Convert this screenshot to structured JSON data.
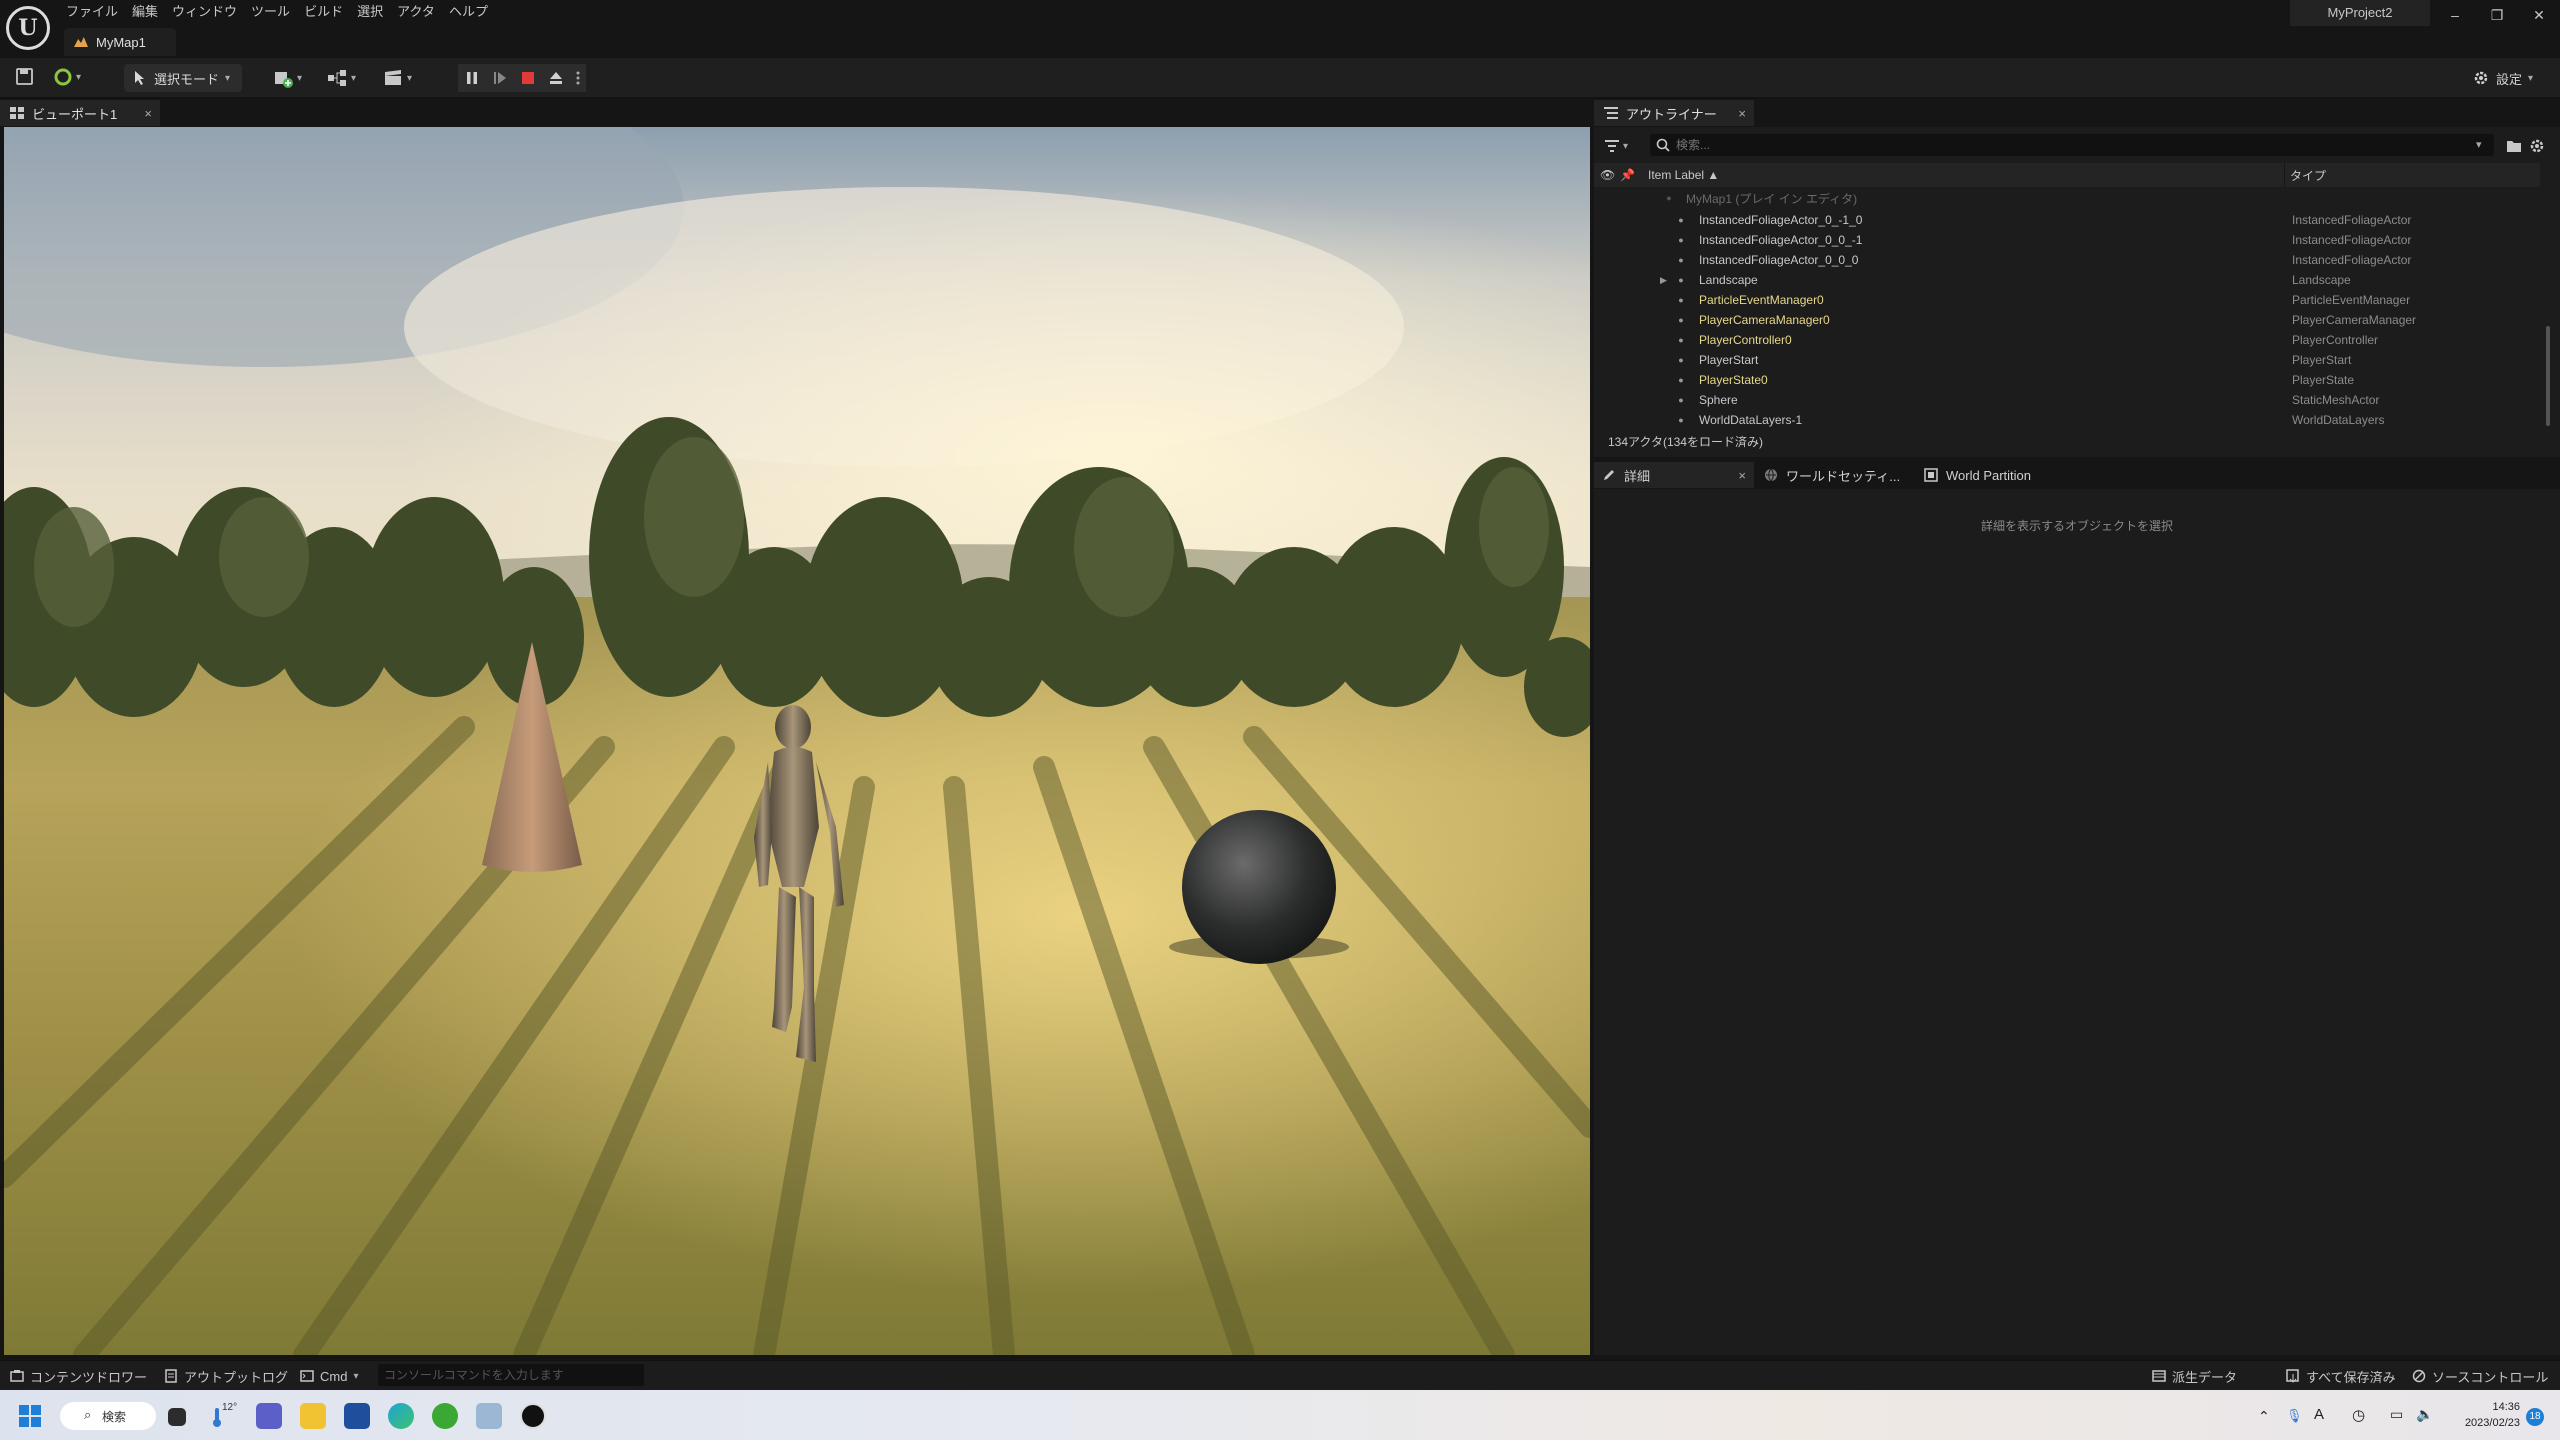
{
  "titlebar": {
    "menu": [
      "ファイル",
      "編集",
      "ウィンドウ",
      "ツール",
      "ビルド",
      "選択",
      "アクタ",
      "ヘルプ"
    ],
    "map_tab": "MyMap1",
    "project": "MyProject2",
    "window_buttons": [
      "–",
      "❐",
      "✕"
    ]
  },
  "toolbar": {
    "mode_label": "選択モード",
    "settings_label": "設定"
  },
  "viewport": {
    "tab_label": "ビューポート1",
    "close": "×"
  },
  "outliner": {
    "tab_label": "アウトライナー",
    "close": "×",
    "search_placeholder": "検索...",
    "col_label": "Item Label ▲",
    "col_type": "タイプ",
    "rows": [
      {
        "label": "MyMap1 (プレイ イン エディタ)",
        "type": "",
        "color": "#6a6a6a"
      },
      {
        "label": "InstancedFoliageActor_0_-1_0",
        "type": "InstancedFoliageActor",
        "color": "#c8c8c8"
      },
      {
        "label": "InstancedFoliageActor_0_0_-1",
        "type": "InstancedFoliageActor",
        "color": "#c8c8c8"
      },
      {
        "label": "InstancedFoliageActor_0_0_0",
        "type": "InstancedFoliageActor",
        "color": "#c8c8c8"
      },
      {
        "label": "Landscape",
        "type": "Landscape",
        "color": "#c8c8c8"
      },
      {
        "label": "ParticleEventManager0",
        "type": "ParticleEventManager",
        "color": "#e8d88a"
      },
      {
        "label": "PlayerCameraManager0",
        "type": "PlayerCameraManager",
        "color": "#e8d88a"
      },
      {
        "label": "PlayerController0",
        "type": "PlayerController",
        "color": "#e8d88a"
      },
      {
        "label": "PlayerStart",
        "type": "PlayerStart",
        "color": "#c8c8c8"
      },
      {
        "label": "PlayerState0",
        "type": "PlayerState",
        "color": "#e8d88a"
      },
      {
        "label": "Sphere",
        "type": "StaticMeshActor",
        "color": "#c8c8c8"
      },
      {
        "label": "WorldDataLayers-1",
        "type": "WorldDataLayers",
        "color": "#c8c8c8"
      }
    ],
    "actor_count": "134アクタ(134をロード済み)"
  },
  "details": {
    "tab1": "詳細",
    "close": "×",
    "tab2": "ワールドセッティ...",
    "tab3": "World Partition",
    "hint": "詳細を表示するオブジェクトを選択"
  },
  "statusbar": {
    "content_drawer": "コンテンツドロワー",
    "output_log": "アウトプットログ",
    "cmd": "Cmd",
    "console_placeholder": "コンソールコマンドを入力します",
    "derived_data": "派生データ",
    "save_all": "すべて保存済み",
    "source_control": "ソースコントロール"
  },
  "taskbar": {
    "search": "検索",
    "weather": "12°",
    "time": "14:36",
    "date": "2023/02/23",
    "notif": "18"
  }
}
